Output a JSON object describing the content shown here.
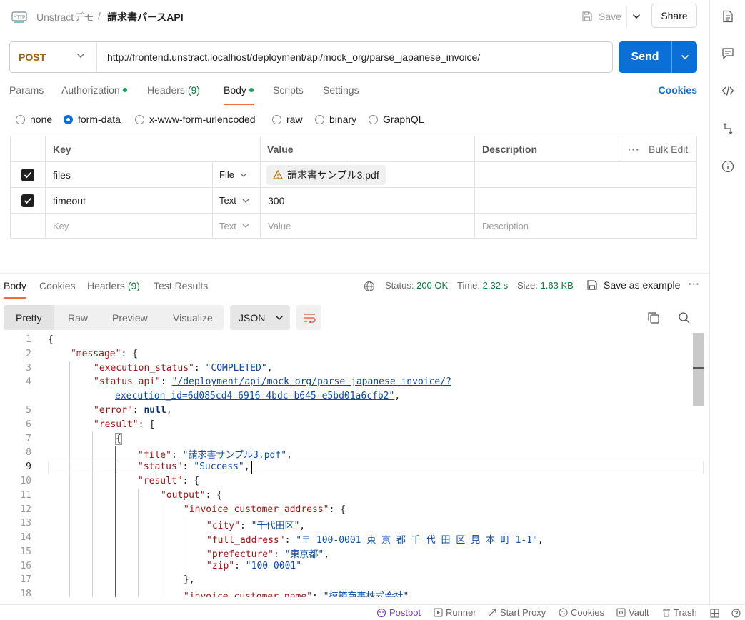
{
  "header": {
    "workspace": "Unstractデモ",
    "separator": "/",
    "request_name": "請求書パースAPI",
    "save_label": "Save",
    "share_label": "Share"
  },
  "request": {
    "method": "POST",
    "url": "http://frontend.unstract.localhost/deployment/api/mock_org/parse_japanese_invoice/",
    "send_label": "Send"
  },
  "request_tabs": {
    "params": "Params",
    "authorization": "Authorization",
    "headers": "Headers",
    "headers_count": "(9)",
    "body": "Body",
    "scripts": "Scripts",
    "settings": "Settings",
    "cookies": "Cookies"
  },
  "body_types": {
    "none": "none",
    "form_data": "form-data",
    "urlencoded": "x-www-form-urlencoded",
    "raw": "raw",
    "binary": "binary",
    "graphql": "GraphQL",
    "selected": "form-data"
  },
  "form_table": {
    "headers": {
      "key": "Key",
      "value": "Value",
      "description": "Description",
      "bulk_edit": "Bulk Edit"
    },
    "rows": [
      {
        "key": "files",
        "type": "File",
        "value": "請求書サンプル3.pdf",
        "checked": true
      },
      {
        "key": "timeout",
        "type": "Text",
        "value": "300",
        "checked": true
      }
    ],
    "placeholder": {
      "key": "Key",
      "type": "Text",
      "value": "Value",
      "description": "Description"
    }
  },
  "response": {
    "tabs": {
      "body": "Body",
      "cookies": "Cookies",
      "headers": "Headers",
      "headers_count": "(9)",
      "test_results": "Test Results"
    },
    "status_label": "Status:",
    "status_value": "200 OK",
    "time_label": "Time:",
    "time_value": "2.32 s",
    "size_label": "Size:",
    "size_value": "1.63 KB",
    "save_example": "Save as example",
    "views": {
      "pretty": "Pretty",
      "raw": "Raw",
      "preview": "Preview",
      "visualize": "Visualize"
    },
    "format": "JSON"
  },
  "code": {
    "line_numbers": [
      "1",
      "2",
      "3",
      "4",
      "",
      "5",
      "6",
      "7",
      "8",
      "9",
      "10",
      "11",
      "12",
      "13",
      "14",
      "15",
      "16",
      "17",
      "18"
    ],
    "k_message": "\"message\"",
    "k_execution_status": "\"execution_status\"",
    "v_execution_status": "\"COMPLETED\"",
    "k_status_api": "\"status_api\"",
    "v_status_api_1": "\"/deployment/api/mock_org/parse_japanese_invoice/?",
    "v_status_api_2": "execution_id=6d085cd4-6916-4bdc-b645-e5bd01a6cfb2\"",
    "k_error": "\"error\"",
    "v_error": "null",
    "k_result": "\"result\"",
    "k_file": "\"file\"",
    "v_file": "\"請求書サンプル3.pdf\"",
    "k_status": "\"status\"",
    "v_status": "\"Success\"",
    "k_result2": "\"result\"",
    "k_output": "\"output\"",
    "k_invoice_customer_address": "\"invoice_customer_address\"",
    "k_city": "\"city\"",
    "v_city": "\"千代田区\"",
    "k_full_address": "\"full_address\"",
    "v_full_address": "\"〒 100-0001 東 京 都 千 代 田 区 見 本 町 1-1\"",
    "k_prefecture": "\"prefecture\"",
    "v_prefecture": "\"東京都\"",
    "k_zip": "\"zip\"",
    "v_zip": "\"100-0001\"",
    "k_invoice_customer_name": "\"invoice_customer_name\"",
    "v_invoice_customer_name": "\"模範商事株式会社\""
  },
  "statusbar": {
    "postbot": "Postbot",
    "runner": "Runner",
    "start_proxy": "Start Proxy",
    "cookies": "Cookies",
    "vault": "Vault",
    "trash": "Trash"
  },
  "colors": {
    "accent": "#0b6fd8",
    "tab_indicator": "#f26b3a",
    "method": "#a0620a",
    "status_ok": "#0b7d3e",
    "postbot": "#7a3ccf"
  }
}
